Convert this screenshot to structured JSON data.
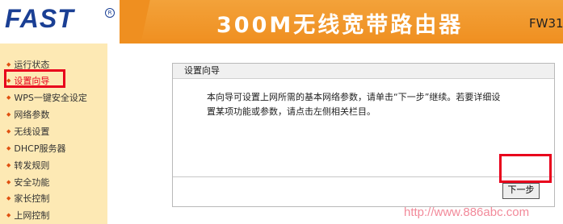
{
  "header": {
    "logo_text": "FAST",
    "product_title": "300M无线宽带路由器",
    "model": "FW31"
  },
  "sidebar": {
    "items": [
      {
        "label": "运行状态"
      },
      {
        "label": "设置向导",
        "active": true
      },
      {
        "label": "WPS一键安全设定"
      },
      {
        "label": "网络参数"
      },
      {
        "label": "无线设置"
      },
      {
        "label": "DHCP服务器"
      },
      {
        "label": "转发规则"
      },
      {
        "label": "安全功能"
      },
      {
        "label": "家长控制"
      },
      {
        "label": "上网控制"
      }
    ]
  },
  "panel": {
    "title": "设置向导",
    "description_line1": "本向导可设置上网所需的基本网络参数，请单击“下一步”继续。若要详细设",
    "description_line2": "置某项功能或参数，请点击左侧相关栏目。",
    "next_label": "下一步"
  },
  "watermark": "http://www.886abc.com",
  "colors": {
    "header_orange": "#ef8f20",
    "sidebar_bg": "#fde9b4",
    "highlight_red": "#e8001c",
    "logo_blue": "#1a3f94"
  }
}
